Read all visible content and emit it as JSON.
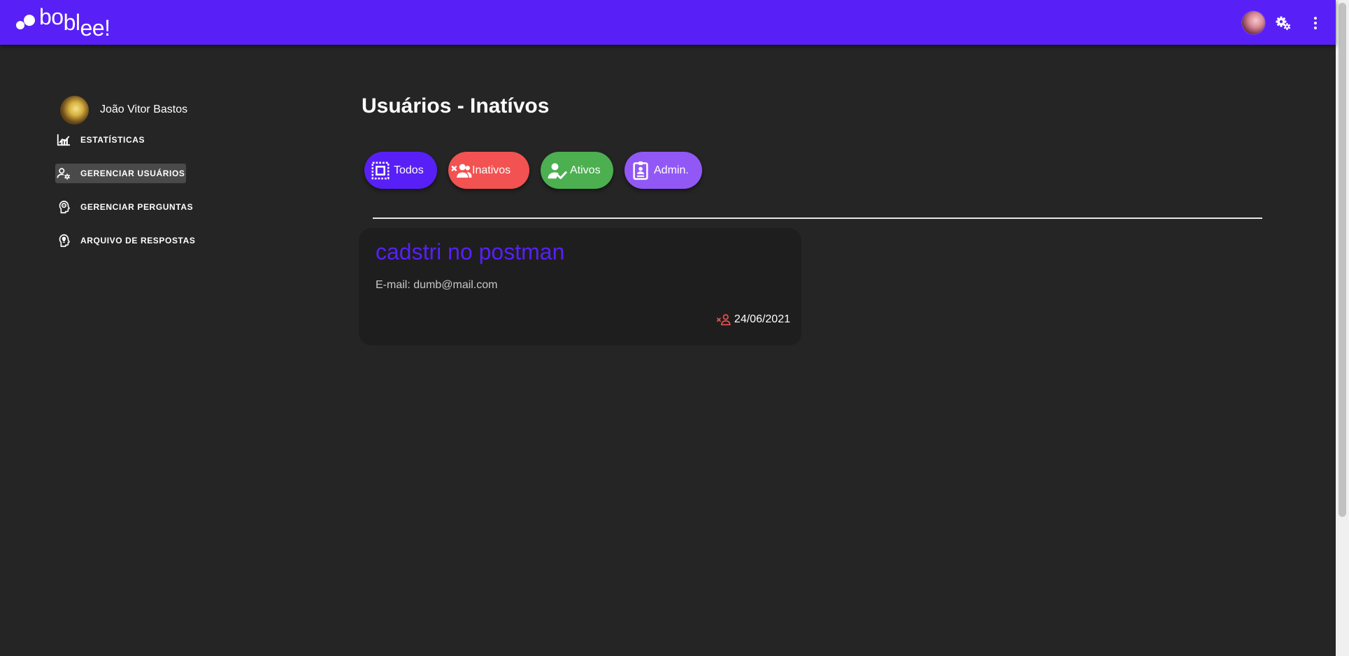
{
  "app": {
    "logo_text": [
      "bo",
      "bl",
      "ee!"
    ],
    "brand_color": "#5820f6"
  },
  "topbar": {
    "icons": [
      "user-avatar",
      "gears-icon",
      "more-vert-icon"
    ]
  },
  "sidebar": {
    "profile_name": "João Vitor Bastos",
    "items": [
      {
        "label": "ESTATÍSTICAS",
        "icon": "stats-icon"
      },
      {
        "label": "GERENCIAR USUÁRIOS",
        "icon": "manage-users-icon",
        "active": true
      },
      {
        "label": "GERENCIAR PERGUNTAS",
        "icon": "head-question-icon"
      },
      {
        "label": "ARQUIVO DE RESPOSTAS",
        "icon": "head-bulb-icon"
      }
    ]
  },
  "main": {
    "title": "Usuários - Inatívos",
    "filters": [
      {
        "label": "Todos",
        "color": "#5820f6",
        "icon": "select-all-icon"
      },
      {
        "label": "Inativos",
        "color": "#f25252",
        "icon": "users-remove-icon"
      },
      {
        "label": "Ativos",
        "color": "#4caf50",
        "icon": "user-check-icon"
      },
      {
        "label": "Admin.",
        "color": "#9258f6",
        "icon": "badge-icon"
      }
    ],
    "users": [
      {
        "name": "cadstri no postman",
        "email": "E-mail: dumb@mail.com",
        "date": "24/06/2021",
        "status_color": "#f25252"
      }
    ]
  }
}
